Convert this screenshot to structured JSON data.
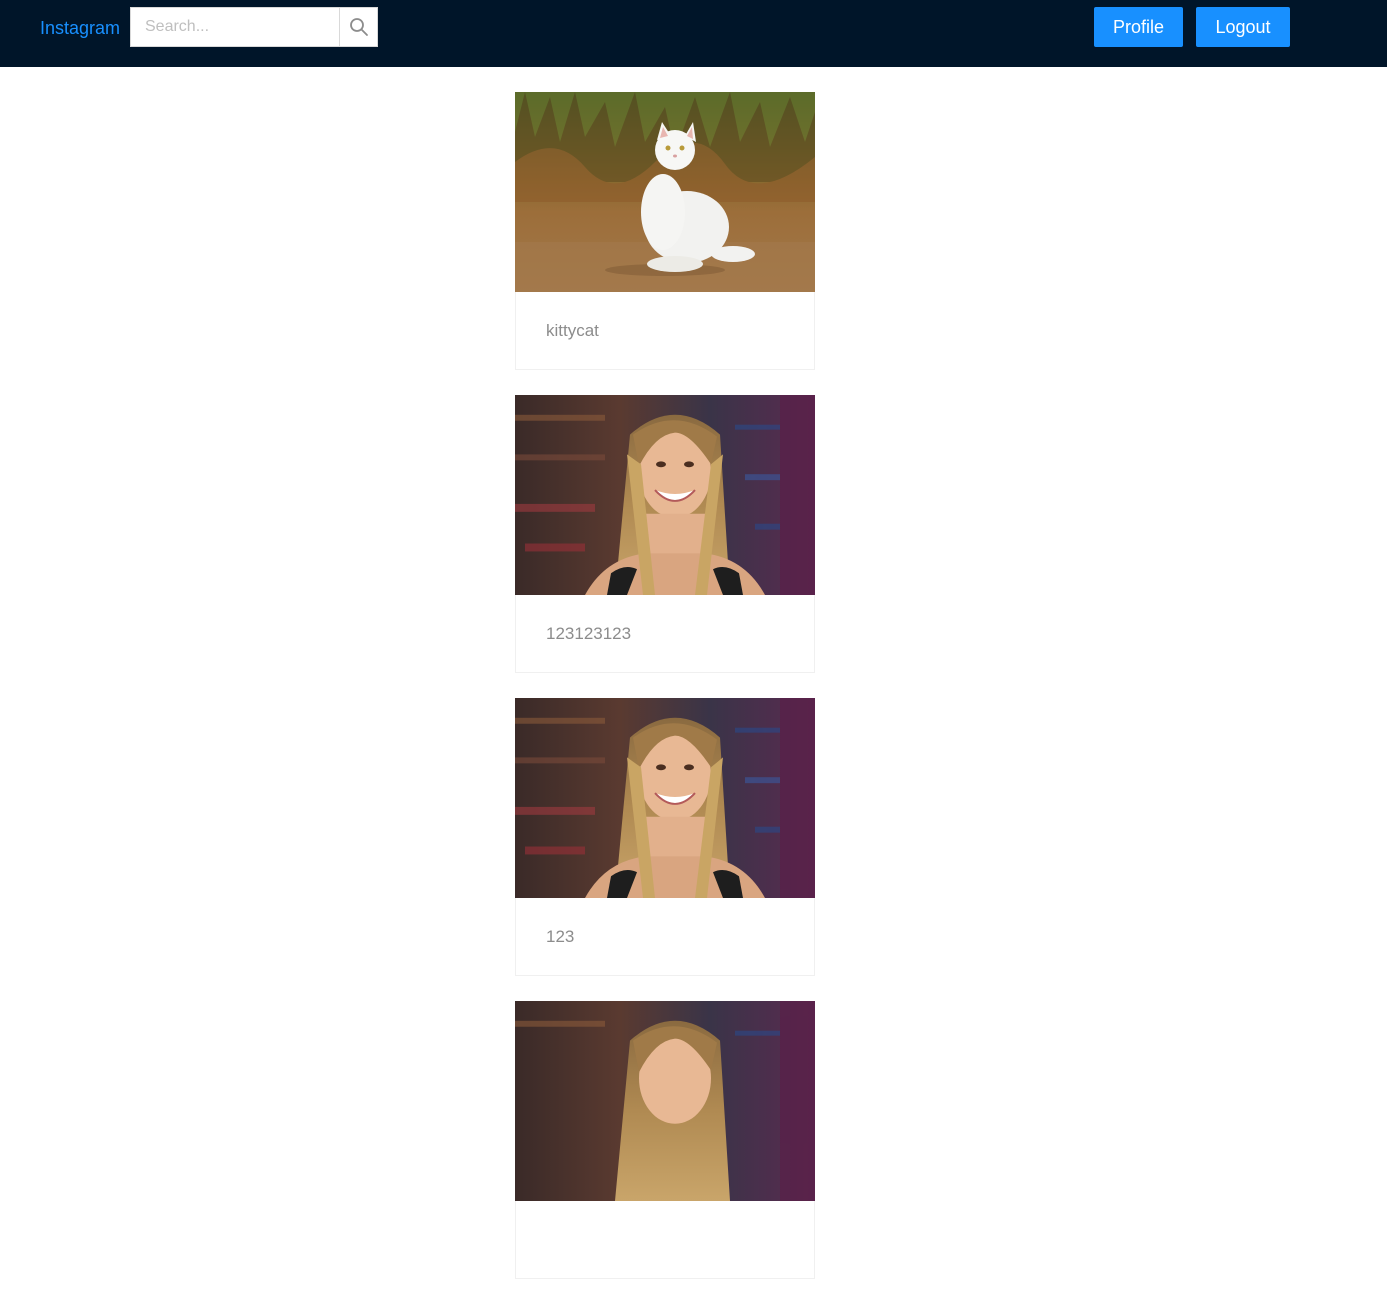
{
  "header": {
    "brand": "Instagram",
    "search": {
      "placeholder": "Search...",
      "value": ""
    },
    "profile_label": "Profile",
    "logout_label": "Logout"
  },
  "icons": {
    "search": "search-icon"
  },
  "colors": {
    "header_bg": "#001529",
    "accent": "#1890ff"
  },
  "feed": {
    "posts": [
      {
        "caption": "kittycat",
        "image": "white-cat-photo"
      },
      {
        "caption": "123123123",
        "image": "smiling-woman-photo"
      },
      {
        "caption": "123",
        "image": "smiling-woman-photo"
      },
      {
        "caption": "",
        "image": "smiling-woman-photo"
      }
    ]
  }
}
